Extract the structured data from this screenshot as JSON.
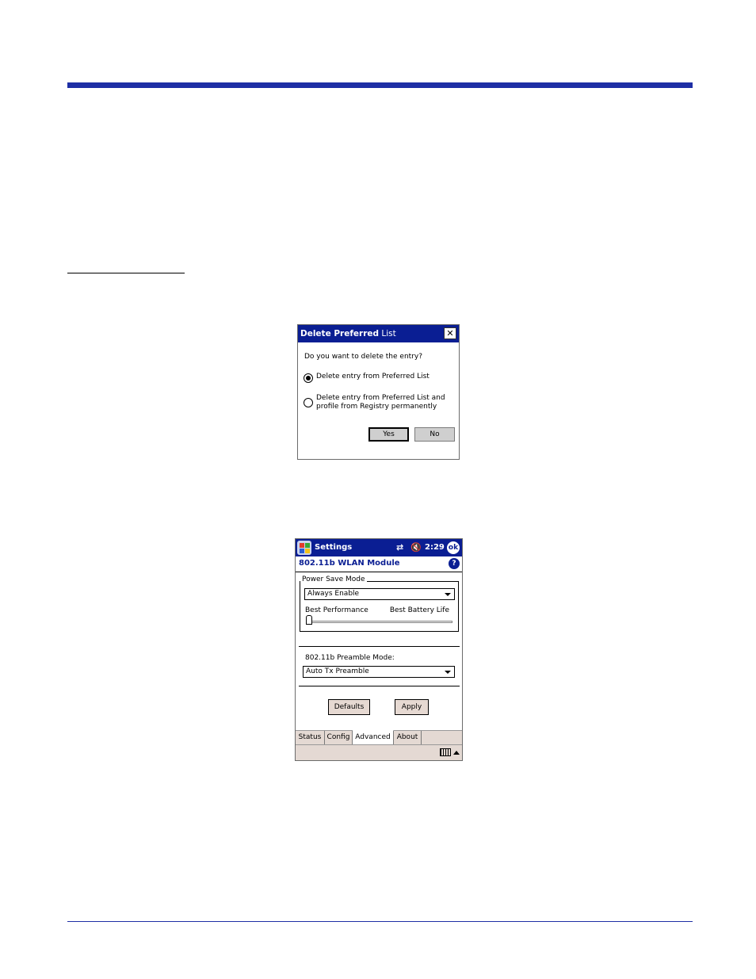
{
  "dialog": {
    "title_bold": "Delete Preferred",
    "title_rest": " List",
    "close_glyph": "✕",
    "question": "Do you want to delete the entry?",
    "options": [
      {
        "label": "Delete entry from Preferred List",
        "checked": true
      },
      {
        "label": "Delete entry from Preferred List and profile from Registry permanently",
        "checked": false
      }
    ],
    "yes_label": "Yes",
    "no_label": "No"
  },
  "settings": {
    "nav_title": "Settings",
    "connectivity_glyph": "⇄",
    "volume_glyph": "🔇",
    "clock": "2:29",
    "ok_label": "ok",
    "page_title": "802.11b WLAN Module",
    "help_glyph": "?",
    "power_save": {
      "legend": "Power Save Mode",
      "selected": "Always Enable",
      "slider_left_label": "Best Performance",
      "slider_right_label": "Best Battery Life",
      "slider_level": 0
    },
    "preamble": {
      "label": "802.11b Preamble Mode:",
      "selected": "Auto Tx Preamble"
    },
    "defaults_label": "Defaults",
    "apply_label": "Apply",
    "tabs": [
      {
        "label": "Status",
        "active": false
      },
      {
        "label": "Config",
        "active": false
      },
      {
        "label": "Advanced",
        "active": true
      },
      {
        "label": "About",
        "active": false
      }
    ]
  },
  "colors": {
    "rule_blue": "#1e2fa5",
    "titlebar_blue": "#0a1e93"
  }
}
